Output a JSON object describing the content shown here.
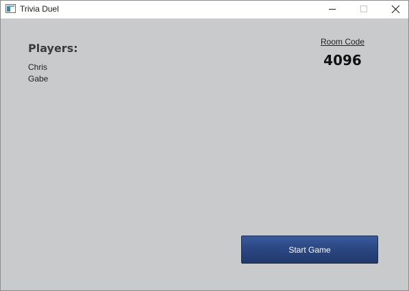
{
  "window": {
    "title": "Trivia Duel",
    "icons": {
      "app": "app-window-icon",
      "minimize": "minimize-icon",
      "maximize": "maximize-icon",
      "close": "close-icon"
    }
  },
  "lobby": {
    "players_heading": "Players:",
    "players": [
      "Chris",
      "Gabe"
    ],
    "room_code_label": "Room Code",
    "room_code": "4096",
    "start_button_label": "Start Game"
  },
  "colors": {
    "background": "#c9cacb",
    "button": "#2b4784",
    "button_text": "#ffffff"
  }
}
